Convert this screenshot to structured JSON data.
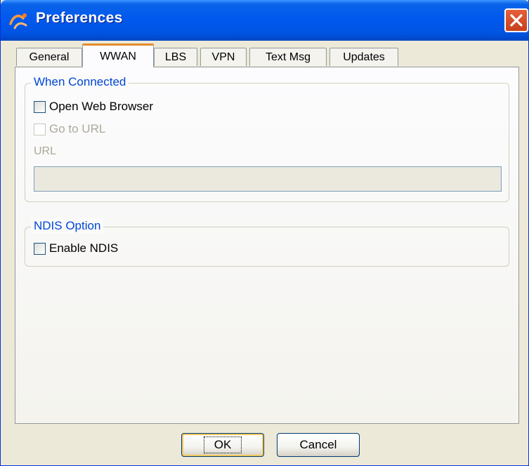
{
  "window": {
    "title": "Preferences",
    "app_icon": "signal-wave-icon",
    "close_icon": "close-icon"
  },
  "tabs": [
    {
      "label": "General",
      "active": false
    },
    {
      "label": "WWAN",
      "active": true
    },
    {
      "label": "LBS",
      "active": false
    },
    {
      "label": "VPN",
      "active": false
    },
    {
      "label": "Text Msg",
      "active": false
    },
    {
      "label": "Updates",
      "active": false
    }
  ],
  "when_connected": {
    "legend": "When Connected",
    "open_browser": {
      "label": "Open Web Browser",
      "checked": false
    },
    "go_to_url": {
      "label": "Go to URL",
      "checked": false,
      "enabled": false
    },
    "url_label": "URL",
    "url_value": ""
  },
  "ndis": {
    "legend": "NDIS Option",
    "enable": {
      "label": "Enable NDIS",
      "checked": false
    }
  },
  "buttons": {
    "ok": "OK",
    "cancel": "Cancel"
  },
  "colors": {
    "title_bar": "#0054e3",
    "active_tab_accent": "#e68b2c",
    "legend_text": "#0046d5",
    "close_button": "#d9552e"
  }
}
